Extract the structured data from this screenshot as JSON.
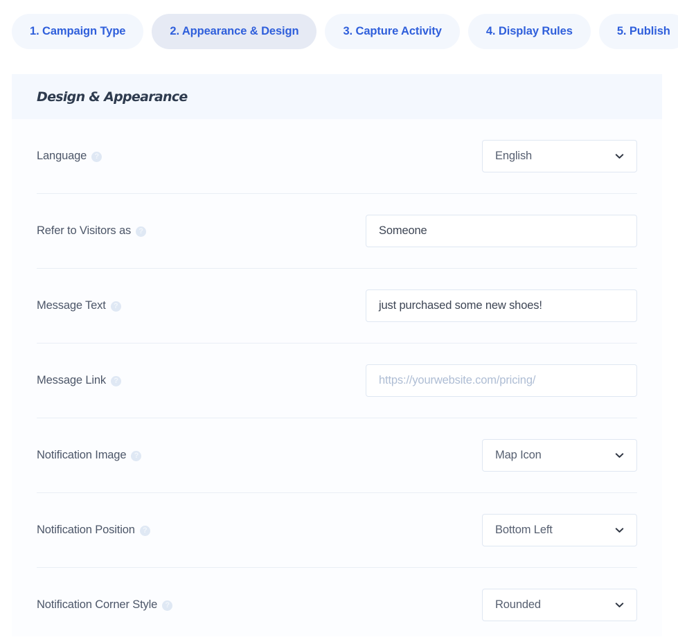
{
  "steps": {
    "tabs": [
      {
        "label": "1. Campaign Type",
        "active": false
      },
      {
        "label": "2. Appearance & Design",
        "active": true
      },
      {
        "label": "3. Capture Activity",
        "active": false
      },
      {
        "label": "4. Display Rules",
        "active": false
      },
      {
        "label": "5. Publish",
        "active": false
      }
    ]
  },
  "panel": {
    "title": "Design & Appearance"
  },
  "help_icon_glyph": "?",
  "rows": [
    {
      "label": "Language",
      "help": "help-icon",
      "control": "select",
      "value": "English",
      "placeholder": ""
    },
    {
      "label": "Refer to Visitors as",
      "help": "help-icon",
      "control": "text",
      "value": "Someone",
      "placeholder": ""
    },
    {
      "label": "Message Text",
      "help": "help-icon",
      "control": "text",
      "value": "just purchased some new shoes!",
      "placeholder": ""
    },
    {
      "label": "Message Link",
      "help": "help-icon",
      "control": "text",
      "value": "",
      "placeholder": "https://yourwebsite.com/pricing/"
    },
    {
      "label": "Notification Image",
      "help": "help-icon",
      "control": "select",
      "value": "Map Icon",
      "placeholder": ""
    },
    {
      "label": "Notification Position",
      "help": "help-icon",
      "control": "select",
      "value": "Bottom Left",
      "placeholder": ""
    },
    {
      "label": "Notification Corner Style",
      "help": "help-icon",
      "control": "select",
      "value": "Rounded",
      "placeholder": ""
    }
  ],
  "colors": {
    "tab_text": "#2f5fdb",
    "tab_bg": "#f3f7fd",
    "tab_bg_active": "#e6eaf4",
    "panel_header_bg": "#f4f8fe",
    "panel_title": "#2e3b4e",
    "label_text": "#4c5668",
    "field_border": "#dfe7f2",
    "placeholder_text": "#aebdd4",
    "divider": "#e9eef5"
  }
}
